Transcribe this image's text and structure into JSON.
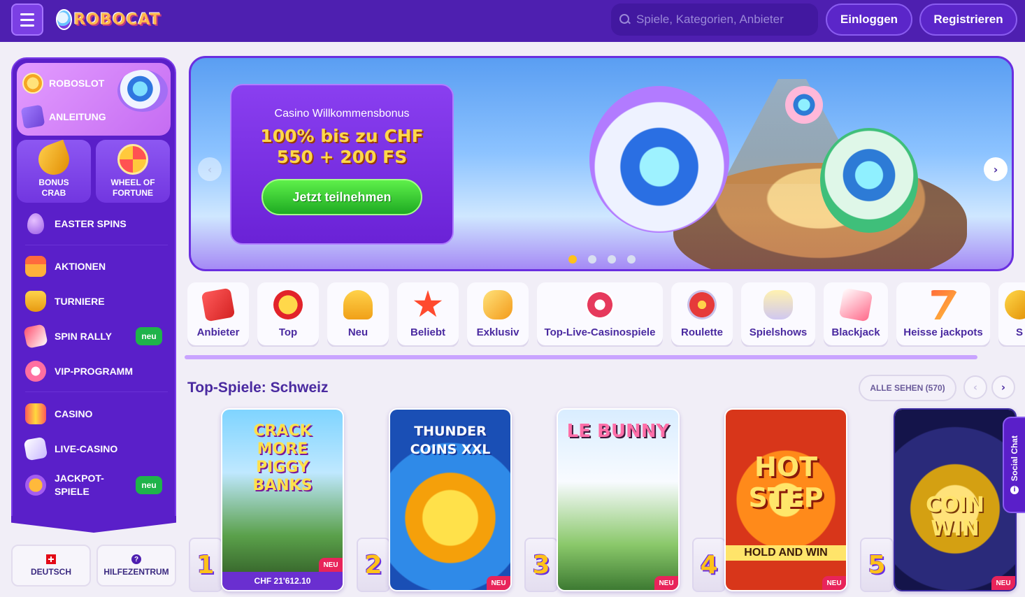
{
  "header": {
    "logo_text": "ROBOCAT",
    "search_placeholder": "Spiele, Kategorien, Anbieter",
    "login_label": "Einloggen",
    "register_label": "Registrieren"
  },
  "sidebar": {
    "top_items": [
      {
        "label": "ROBOSLOT",
        "icon": "coin-icon"
      },
      {
        "label": "ANLEITUNG",
        "icon": "book-icon"
      }
    ],
    "tiles": [
      {
        "label": "BONUS CRAB",
        "icon": "crab-claw-icon"
      },
      {
        "label": "WHEEL OF FORTUNE",
        "icon": "wheel-icon"
      }
    ],
    "items": [
      {
        "label": "EASTER SPINS",
        "icon": "egg-icon"
      },
      {
        "label": "AKTIONEN",
        "icon": "gift-icon"
      },
      {
        "label": "TURNIERE",
        "icon": "trophy-icon"
      },
      {
        "label": "SPIN RALLY",
        "icon": "dice-icon",
        "badge": "neu"
      },
      {
        "label": "VIP-PROGRAMM",
        "icon": "vip-icon"
      },
      {
        "label": "CASINO",
        "icon": "slot-icon"
      },
      {
        "label": "LIVE-CASINO",
        "icon": "cards-icon"
      },
      {
        "label": "JACKPOT-SPIELE",
        "icon": "seven-icon",
        "badge": "neu"
      }
    ],
    "language_label": "DEUTSCH",
    "help_label": "HILFEZENTRUM"
  },
  "banner": {
    "subtitle": "Casino Willkommensbonus",
    "title": "100% bis zu CHF 550 + 200 FS",
    "cta_label": "Jetzt teilnehmen",
    "slides_total": 4,
    "active_slide": 1
  },
  "categories": [
    {
      "label": "Anbieter",
      "icon": "provider-icon"
    },
    {
      "label": "Top",
      "icon": "medal-icon"
    },
    {
      "label": "Neu",
      "icon": "bell-icon"
    },
    {
      "label": "Beliebt",
      "icon": "star-icon"
    },
    {
      "label": "Exklusiv",
      "icon": "gem-icon"
    },
    {
      "label": "Top-Live-Casinospiele",
      "icon": "live-chip-icon"
    },
    {
      "label": "Roulette",
      "icon": "roulette-icon"
    },
    {
      "label": "Spielshows",
      "icon": "show-icon"
    },
    {
      "label": "Blackjack",
      "icon": "blackjack-icon"
    },
    {
      "label": "Heisse jackpots",
      "icon": "jackpot-icon"
    },
    {
      "label": "S",
      "icon": "more-icon"
    }
  ],
  "top_games": {
    "title": "Top-Spiele: Schweiz",
    "see_all_label": "ALLE SEHEN (570)",
    "games": [
      {
        "rank": "1",
        "name": "CRACK MORE PIGGY BANKS",
        "badge": "NEU",
        "jackpot": "CHF 21'612.10"
      },
      {
        "rank": "2",
        "name": "THUNDER COINS XXL",
        "badge": "NEU"
      },
      {
        "rank": "3",
        "name": "LE BUNNY",
        "badge": "NEU"
      },
      {
        "rank": "4",
        "name": "HOT STEP",
        "sub": "HOLD AND WIN",
        "badge": "NEU"
      },
      {
        "rank": "5",
        "name": "COIN WIN",
        "badge": "NEU"
      }
    ]
  },
  "social_chat_label": "Social Chat"
}
